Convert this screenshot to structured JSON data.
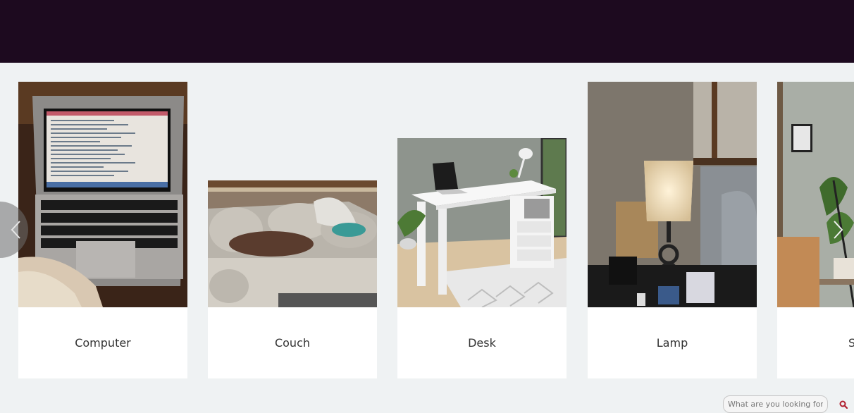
{
  "carousel": {
    "items": [
      {
        "label": "Computer"
      },
      {
        "label": "Couch"
      },
      {
        "label": "Desk"
      },
      {
        "label": "Lamp"
      },
      {
        "label": "S"
      }
    ]
  },
  "search": {
    "placeholder": "What are you looking for?"
  },
  "colors": {
    "header": "#1d0a1f",
    "background": "#eff2f3",
    "search_icon": "#b01e2e"
  }
}
